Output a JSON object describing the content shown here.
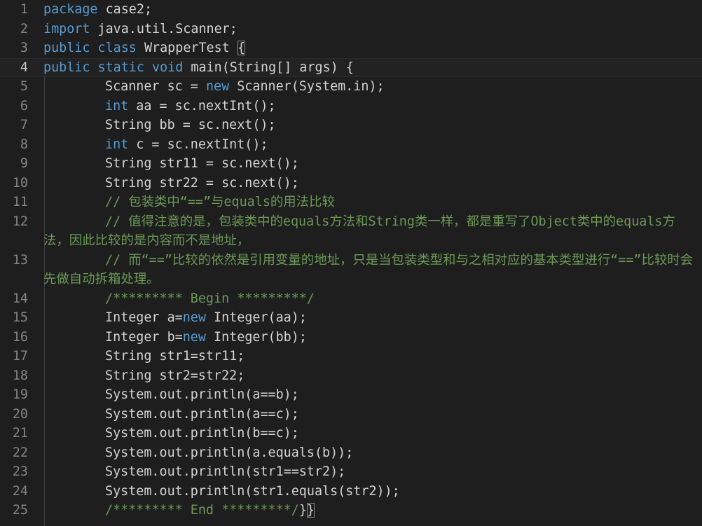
{
  "editor": {
    "lines": [
      {
        "n": "1",
        "indent": false,
        "tokens": [
          {
            "t": "package",
            "c": "kw"
          },
          {
            "t": " case2;",
            "c": "pl"
          }
        ]
      },
      {
        "n": "2",
        "indent": false,
        "tokens": [
          {
            "t": "import",
            "c": "kw"
          },
          {
            "t": " java.util.Scanner;",
            "c": "pl"
          }
        ]
      },
      {
        "n": "3",
        "indent": false,
        "tokens": [
          {
            "t": "public",
            "c": "kw"
          },
          {
            "t": " ",
            "c": "pl"
          },
          {
            "t": "class",
            "c": "kw"
          },
          {
            "t": " WrapperTest ",
            "c": "pl"
          },
          {
            "t": "{",
            "c": "hl"
          }
        ]
      },
      {
        "n": "4",
        "indent": false,
        "current": true,
        "tokens": [
          {
            "t": "public",
            "c": "kw"
          },
          {
            "t": " ",
            "c": "pl"
          },
          {
            "t": "static",
            "c": "kw"
          },
          {
            "t": " ",
            "c": "pl"
          },
          {
            "t": "void",
            "c": "kw"
          },
          {
            "t": " main(String[] args) {",
            "c": "pl"
          }
        ]
      },
      {
        "n": "5",
        "indent": true,
        "tokens": [
          {
            "t": "Scanner sc = ",
            "c": "pl"
          },
          {
            "t": "new",
            "c": "kw"
          },
          {
            "t": " Scanner(System.in);",
            "c": "pl"
          }
        ]
      },
      {
        "n": "6",
        "indent": true,
        "tokens": [
          {
            "t": "int",
            "c": "kw"
          },
          {
            "t": " aa = sc.nextInt();",
            "c": "pl"
          }
        ]
      },
      {
        "n": "7",
        "indent": true,
        "tokens": [
          {
            "t": "String bb = sc.next();",
            "c": "pl"
          }
        ]
      },
      {
        "n": "8",
        "indent": true,
        "tokens": [
          {
            "t": "int",
            "c": "kw"
          },
          {
            "t": " c = sc.nextInt();",
            "c": "pl"
          }
        ]
      },
      {
        "n": "9",
        "indent": true,
        "tokens": [
          {
            "t": "String str11 = sc.next();",
            "c": "pl"
          }
        ]
      },
      {
        "n": "10",
        "indent": true,
        "tokens": [
          {
            "t": "String str22 = sc.next();",
            "c": "pl"
          }
        ]
      },
      {
        "n": "11",
        "indent": true,
        "tokens": [
          {
            "t": "// 包装类中“==”与equals的用法比较",
            "c": "cm"
          }
        ]
      },
      {
        "n": "12",
        "indent": true,
        "tokens": [
          {
            "t": "// 值得注意的是，包装类中的equals方法和String类一样，都是重写了Object类中的equals方法，因此比较的是内容而不是地址，",
            "c": "cm"
          }
        ]
      },
      {
        "n": "13",
        "indent": true,
        "tokens": [
          {
            "t": "// 而“==”比较的依然是引用变量的地址，只是当包装类型和与之相对应的基本类型进行“==”比较时会先做自动拆箱处理。",
            "c": "cm"
          }
        ]
      },
      {
        "n": "14",
        "indent": true,
        "tokens": [
          {
            "t": "/********* Begin *********/",
            "c": "cm"
          }
        ]
      },
      {
        "n": "15",
        "indent": true,
        "tokens": [
          {
            "t": "Integer a=",
            "c": "pl"
          },
          {
            "t": "new",
            "c": "kw"
          },
          {
            "t": " Integer(aa);",
            "c": "pl"
          }
        ]
      },
      {
        "n": "16",
        "indent": true,
        "tokens": [
          {
            "t": "Integer b=",
            "c": "pl"
          },
          {
            "t": "new",
            "c": "kw"
          },
          {
            "t": " Integer(bb);",
            "c": "pl"
          }
        ]
      },
      {
        "n": "17",
        "indent": true,
        "tokens": [
          {
            "t": "String str1=str11;",
            "c": "pl"
          }
        ]
      },
      {
        "n": "18",
        "indent": true,
        "tokens": [
          {
            "t": "String str2=str22;",
            "c": "pl"
          }
        ]
      },
      {
        "n": "19",
        "indent": true,
        "tokens": [
          {
            "t": "System.out.println(a==b);",
            "c": "pl"
          }
        ]
      },
      {
        "n": "20",
        "indent": true,
        "tokens": [
          {
            "t": "System.out.println(a==c);",
            "c": "pl"
          }
        ]
      },
      {
        "n": "21",
        "indent": true,
        "tokens": [
          {
            "t": "System.out.println(b==c);",
            "c": "pl"
          }
        ]
      },
      {
        "n": "22",
        "indent": true,
        "tokens": [
          {
            "t": "System.out.println(a.equals(b));",
            "c": "pl"
          }
        ]
      },
      {
        "n": "23",
        "indent": true,
        "tokens": [
          {
            "t": "System.out.println(str1==str2);",
            "c": "pl"
          }
        ]
      },
      {
        "n": "24",
        "indent": true,
        "tokens": [
          {
            "t": "System.out.println(str1.equals(str2));",
            "c": "pl"
          }
        ]
      },
      {
        "n": "25",
        "indent": true,
        "tokens": [
          {
            "t": "/********* End *********/",
            "c": "cm"
          },
          {
            "t": "}",
            "c": "pl"
          },
          {
            "t": "}",
            "c": "hl"
          }
        ]
      }
    ],
    "colors": {
      "background": "#1e1e1e",
      "keyword": "#569cd6",
      "comment": "#6a9955",
      "text": "#d4d4d4",
      "line_number": "#858585"
    }
  }
}
